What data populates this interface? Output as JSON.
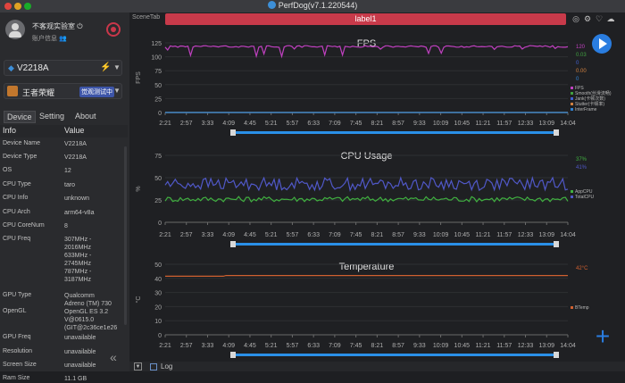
{
  "window": {
    "title": "PerfDog(v7.1.220544)"
  },
  "sidebar": {
    "user": {
      "name": "不客观实验室",
      "account_label": "账户信息"
    },
    "device": {
      "name": "V2218A"
    },
    "app": {
      "name": "王者荣耀",
      "badge": "觉观测试中"
    },
    "tabs": [
      {
        "label": "Device"
      },
      {
        "label": "Setting"
      },
      {
        "label": "About"
      }
    ],
    "info_header": {
      "info": "Info",
      "value": "Value"
    },
    "info_rows": [
      {
        "key": "Device Name",
        "value": "V2218A"
      },
      {
        "key": "Device Type",
        "value": "V2218A"
      },
      {
        "key": "OS",
        "value": "12"
      },
      {
        "key": "CPU Type",
        "value": "taro"
      },
      {
        "key": "CPU Info",
        "value": "unknown"
      },
      {
        "key": "CPU Arch",
        "value": "arm64-v8a"
      },
      {
        "key": "CPU CoreNum",
        "value": "8"
      },
      {
        "key": "CPU Freq",
        "value": "307MHz -\n2016MHz\n633MHz -\n2745MHz\n787MHz -\n3187MHz"
      },
      {
        "key": "GPU Type",
        "value": "Qualcomm"
      },
      {
        "key": "OpenGL",
        "value": "Adreno (TM) 730\nOpenGL ES 3.2\nV@0615.0\n(GIT@2c36ce1e26"
      },
      {
        "key": "GPU Freq",
        "value": "unavailable"
      },
      {
        "key": "Resolution",
        "value": "unavailable"
      },
      {
        "key": "Screen Size",
        "value": "unavailable"
      },
      {
        "key": "Ram Size",
        "value": "11.1 GB"
      }
    ]
  },
  "main": {
    "scene_tab": "SceneTab",
    "label": "label1",
    "log_label": "Log"
  },
  "colors": {
    "fps": "#c040c0",
    "smooth": "#40a040",
    "jank": "#4060d0",
    "stutter": "#d08040",
    "interframe": "#3080d0",
    "appcpu": "#40b040",
    "totalcpu": "#5058c8",
    "btemp": "#d06030",
    "accent": "#2a7de0"
  },
  "chart_data": [
    {
      "type": "line",
      "title": "FPS",
      "ylabel": "FPS",
      "ylim": [
        0,
        125
      ],
      "yticks": [
        "0",
        "25",
        "50",
        "75",
        "100",
        "125"
      ],
      "x_ticks": [
        "2:21",
        "2:57",
        "3:33",
        "4:09",
        "4:45",
        "5:21",
        "5:57",
        "6:33",
        "7:09",
        "7:45",
        "8:21",
        "8:57",
        "9:33",
        "10:09",
        "10:45",
        "11:21",
        "11:57",
        "12:33",
        "13:09",
        "14:04"
      ],
      "legend_values": [
        {
          "text": "120",
          "color": "#c040c0"
        },
        {
          "text": "0.03",
          "color": "#40a040"
        },
        {
          "text": "0",
          "color": "#4060d0"
        },
        {
          "text": "0.00",
          "color": "#d08040"
        },
        {
          "text": "0",
          "color": "#3080d0"
        }
      ],
      "series": [
        {
          "name": "FPS",
          "baseline": 120,
          "color": "#c040c0"
        },
        {
          "name": "Smooth(丝滑流畅)",
          "baseline": 0,
          "color": "#40a040"
        },
        {
          "name": "Jank(卡顿次数)",
          "baseline": 0,
          "color": "#4060d0"
        },
        {
          "name": "Stutter(卡顿率)",
          "baseline": 0,
          "color": "#d08040"
        },
        {
          "name": "InterFrame",
          "baseline": 0,
          "color": "#3080d0"
        }
      ]
    },
    {
      "type": "line",
      "title": "CPU Usage",
      "ylabel": "%",
      "ylim": [
        0,
        75
      ],
      "yticks": [
        "0",
        "25",
        "50",
        "75"
      ],
      "x_ticks": [
        "2:21",
        "2:57",
        "3:33",
        "4:09",
        "4:45",
        "5:21",
        "5:57",
        "6:33",
        "7:09",
        "7:45",
        "8:21",
        "8:57",
        "9:33",
        "10:09",
        "10:45",
        "11:21",
        "11:57",
        "12:33",
        "13:09",
        "14:04"
      ],
      "legend_values": [
        {
          "text": "37%",
          "color": "#40b040"
        },
        {
          "text": "41%",
          "color": "#5058c8"
        }
      ],
      "series": [
        {
          "name": "AppCPU",
          "baseline": 26,
          "color": "#40b040"
        },
        {
          "name": "TotalCPU",
          "baseline": 43,
          "color": "#5058c8"
        }
      ]
    },
    {
      "type": "line",
      "title": "Temperature",
      "ylabel": "°C",
      "ylim": [
        0,
        50
      ],
      "yticks": [
        "0",
        "10",
        "20",
        "30",
        "40",
        "50"
      ],
      "x_ticks": [
        "2:21",
        "2:57",
        "3:33",
        "4:09",
        "4:45",
        "5:21",
        "5:57",
        "6:33",
        "7:09",
        "7:45",
        "8:21",
        "8:57",
        "9:33",
        "10:09",
        "10:45",
        "11:21",
        "11:57",
        "12:33",
        "13:09",
        "14:04"
      ],
      "legend_values": [
        {
          "text": "42°C",
          "color": "#d06030"
        }
      ],
      "series": [
        {
          "name": "BTemp",
          "values": [
            41.5,
            41.5,
            41.5,
            42,
            42,
            42,
            42,
            42,
            42,
            42,
            42,
            42,
            42,
            42,
            42,
            42,
            42,
            42,
            42,
            42
          ],
          "color": "#d06030"
        }
      ]
    }
  ]
}
